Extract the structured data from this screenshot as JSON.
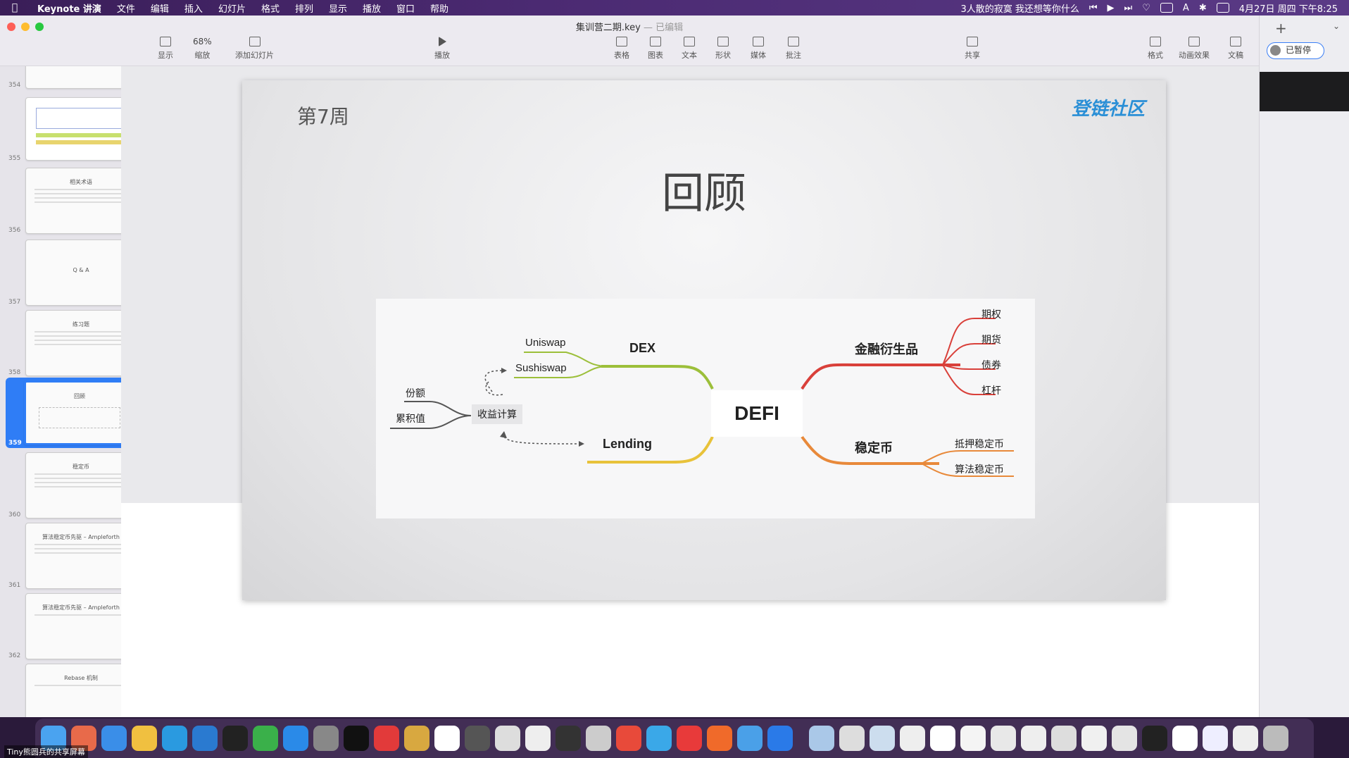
{
  "menubar": {
    "app": "Keynote 讲演",
    "items": [
      "文件",
      "编辑",
      "插入",
      "幻灯片",
      "格式",
      "排列",
      "显示",
      "播放",
      "窗口",
      "帮助"
    ],
    "now_playing": "3人散的寂寞 我还想等你什么",
    "ime": "A",
    "datetime": "4月27日 周四 下午8:25"
  },
  "window": {
    "doc_name": "集训营二期.key",
    "doc_status": "— 已编辑",
    "toolbar": {
      "view": "显示",
      "zoom_value": "68%",
      "zoom": "缩放",
      "add_slide": "添加幻灯片",
      "play": "播放",
      "table": "表格",
      "chart": "图表",
      "text": "文本",
      "shape": "形状",
      "media": "媒体",
      "comment": "批注",
      "share": "共享",
      "format": "格式",
      "animate": "动画效果",
      "document": "文稿"
    },
    "paused_label": "已暂停"
  },
  "navigator": {
    "slides": [
      {
        "num": "354",
        "title": ""
      },
      {
        "num": "355",
        "title": ""
      },
      {
        "num": "356",
        "title": "相关术语"
      },
      {
        "num": "357",
        "title": "Q & A"
      },
      {
        "num": "358",
        "title": "练习题"
      },
      {
        "num": "359",
        "title": "回顾"
      },
      {
        "num": "360",
        "title": "稳定币"
      },
      {
        "num": "361",
        "title": "算法稳定币先驱 – Ampleforth"
      },
      {
        "num": "362",
        "title": "算法稳定币先驱 – Ampleforth"
      },
      {
        "num": "",
        "title": "Rebase 机制"
      }
    ],
    "selected_index": 5
  },
  "slide": {
    "week": "第7周",
    "logo": "登链社区",
    "title": "回顾",
    "mindmap": {
      "center": "DEFI",
      "dex": "DEX",
      "uniswap": "Uniswap",
      "sushiswap": "Sushiswap",
      "lending": "Lending",
      "yield_calc": "收益计算",
      "share": "份额",
      "accum": "累积值",
      "derivatives": "金融衍生品",
      "options": "期权",
      "futures": "期货",
      "bonds": "债券",
      "leverage": "杠杆",
      "stablecoin": "稳定币",
      "collateral_stable": "抵押稳定币",
      "algo_stable": "算法稳定币"
    }
  },
  "share_note": "Tiny熊圆兵的共享屏幕"
}
